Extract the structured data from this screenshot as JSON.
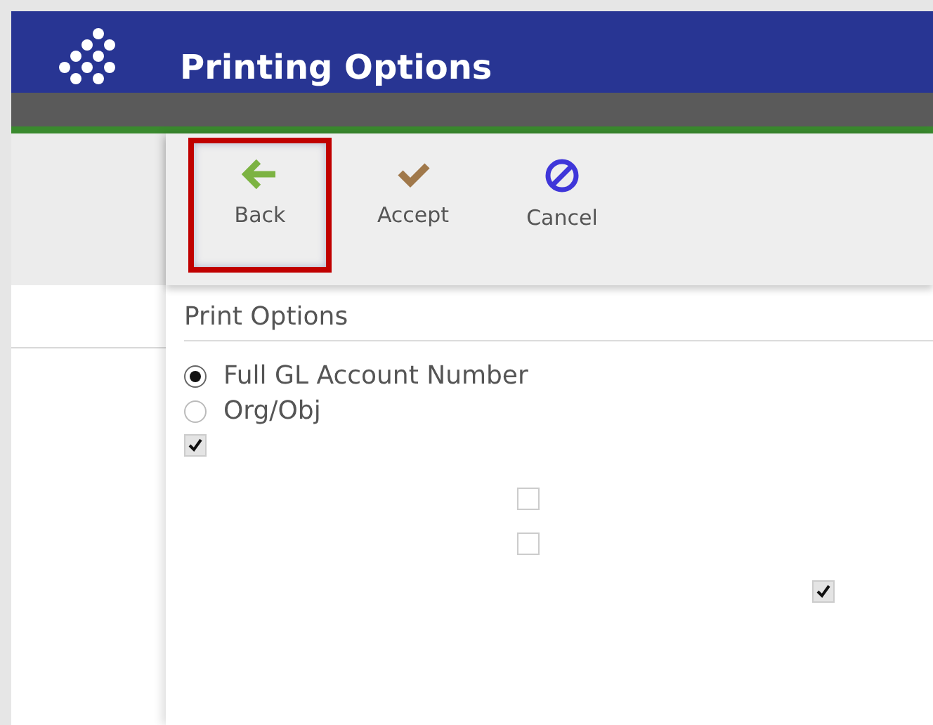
{
  "header": {
    "title": "Printing Options"
  },
  "toolbar": [
    {
      "label": "Back",
      "kind": "back",
      "selected": true
    },
    {
      "label": "Accept",
      "kind": "accept",
      "selected": false
    },
    {
      "label": "Cancel",
      "kind": "cancel",
      "selected": false
    }
  ],
  "section": {
    "title": "Print Options"
  },
  "radios": [
    {
      "label": "Full GL Account Number",
      "selected": true
    },
    {
      "label": "Org/Obj",
      "selected": false
    }
  ],
  "checkboxes": [
    {
      "checked": true
    },
    {
      "checked": false
    },
    {
      "checked": false
    },
    {
      "checked": true
    }
  ]
}
